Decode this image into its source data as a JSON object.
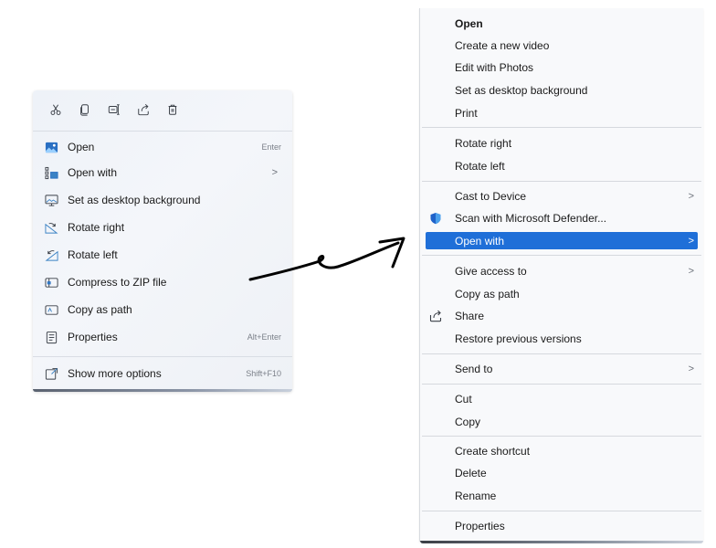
{
  "modern_menu": {
    "quick_actions": [
      {
        "icon": "cut-icon"
      },
      {
        "icon": "copy-icon"
      },
      {
        "icon": "rename-icon"
      },
      {
        "icon": "share-icon"
      },
      {
        "icon": "delete-icon"
      }
    ],
    "items": [
      {
        "label": "Open",
        "shortcut": "Enter",
        "icon": "photo-icon"
      },
      {
        "label": "Open with",
        "chevron": ">",
        "icon": "open-with-icon"
      },
      {
        "label": "Set as desktop background",
        "icon": "desktop-icon"
      },
      {
        "label": "Rotate right",
        "icon": "rotate-right-icon"
      },
      {
        "label": "Rotate left",
        "icon": "rotate-left-icon"
      },
      {
        "label": "Compress to ZIP file",
        "icon": "zip-icon"
      },
      {
        "label": "Copy as path",
        "icon": "copy-path-icon"
      },
      {
        "label": "Properties",
        "shortcut": "Alt+Enter",
        "icon": "properties-icon"
      },
      {
        "label": "Show more options",
        "shortcut": "Shift+F10",
        "icon": "more-options-icon"
      }
    ]
  },
  "classic_menu": {
    "items": [
      {
        "label": "Open"
      },
      {
        "label": "Create a new video"
      },
      {
        "label": "Edit with Photos"
      },
      {
        "label": "Set as desktop background"
      },
      {
        "label": "Print"
      },
      {
        "label": "Rotate right"
      },
      {
        "label": "Rotate left"
      },
      {
        "label": "Cast to Device",
        "chevron": ">"
      },
      {
        "label": "Scan with Microsoft Defender...",
        "icon": "defender-shield-icon"
      },
      {
        "label": "Open with",
        "chevron": ">"
      },
      {
        "label": "Give access to",
        "chevron": ">"
      },
      {
        "label": "Copy as path"
      },
      {
        "label": "Share",
        "icon": "share-icon"
      },
      {
        "label": "Restore previous versions"
      },
      {
        "label": "Send to",
        "chevron": ">"
      },
      {
        "label": "Cut"
      },
      {
        "label": "Copy"
      },
      {
        "label": "Create shortcut"
      },
      {
        "label": "Delete"
      },
      {
        "label": "Rename"
      },
      {
        "label": "Properties"
      }
    ]
  },
  "colors": {
    "highlight": "#1f6fd8",
    "accent_icon": "#3b82c4",
    "arrow": "#000000"
  }
}
